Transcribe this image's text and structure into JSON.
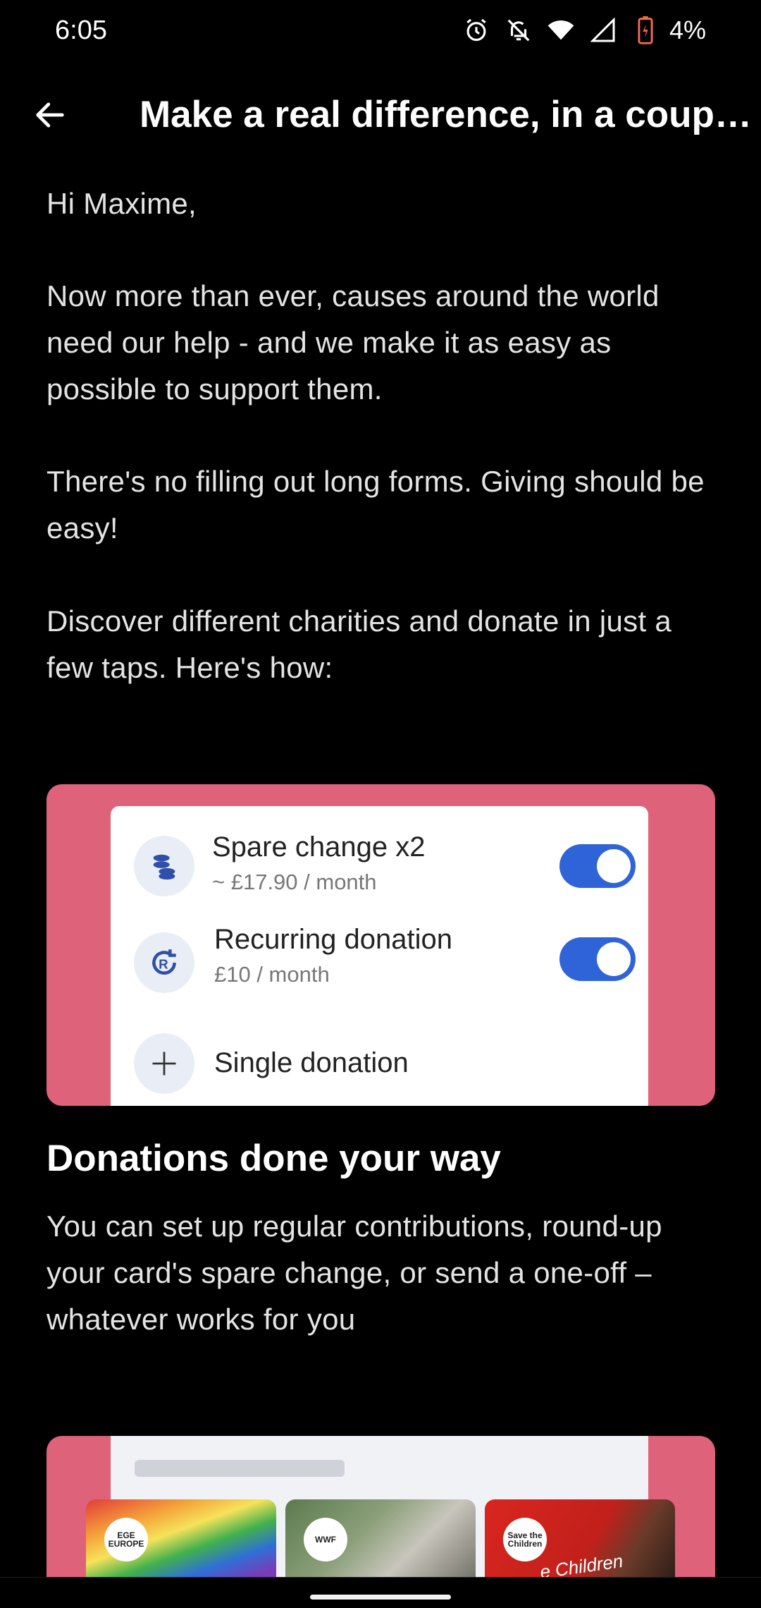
{
  "status_bar": {
    "time": "6:05",
    "battery": "4%"
  },
  "app_bar": {
    "title": "Make a real difference, in a couple of taps"
  },
  "body": {
    "greeting": "Hi Maxime,",
    "paragraph_1": "Now more than ever, causes around the world need our help - and we make it as easy as possible to support them.",
    "paragraph_2": "There's no filling out long forms. Giving should be easy!",
    "paragraph_3": "Discover different charities and donate in just a few taps. Here's how:"
  },
  "donation_card": {
    "rows": [
      {
        "title": "Spare change x2",
        "subtitle": "~ £17.90 / month",
        "icon": "coins-icon",
        "toggle_on": true
      },
      {
        "title": "Recurring donation",
        "subtitle": "£10 / month",
        "icon": "recurring-icon",
        "toggle_on": true
      },
      {
        "title": "Single donation",
        "subtitle": "",
        "icon": "plus-icon",
        "toggle_on": null
      }
    ]
  },
  "section": {
    "heading": "Donations done your way",
    "description": "You can set up regular contributions, round-up your card's spare change, or send a one-off – whatever works for you"
  },
  "charities_card": {
    "logos": [
      {
        "icon": "pride-flag-logo",
        "label": "EGE EUROPE"
      },
      {
        "icon": "wwf-panda-logo",
        "label": "WWF"
      },
      {
        "icon": "save-the-children-logo",
        "label": "Save the Children",
        "banner": "e Children"
      }
    ]
  },
  "colors": {
    "card_pink": "#de6279",
    "toggle_blue": "#2f63d8",
    "background": "#000000"
  }
}
